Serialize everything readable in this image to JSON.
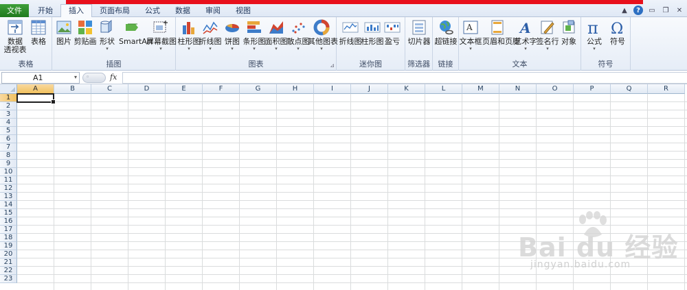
{
  "menu": {
    "tabs": [
      {
        "label": "文件"
      },
      {
        "label": "开始"
      },
      {
        "label": "插入"
      },
      {
        "label": "页面布局"
      },
      {
        "label": "公式"
      },
      {
        "label": "数据"
      },
      {
        "label": "审阅"
      },
      {
        "label": "视图"
      }
    ],
    "active_tab": "插入"
  },
  "ribbon": {
    "groups": {
      "tables": {
        "label": "表格",
        "pivot_line1": "数据",
        "pivot_line2": "透视表",
        "table": "表格"
      },
      "illustrations": {
        "label": "插图",
        "picture": "图片",
        "clipart": "剪贴画",
        "shapes": "形状",
        "smartart": "SmartArt",
        "screenshot": "屏幕截图"
      },
      "charts": {
        "label": "图表",
        "column": "柱形图",
        "line": "折线图",
        "pie": "饼图",
        "bar": "条形图",
        "area": "面积图",
        "scatter": "散点图",
        "other": "其他图表"
      },
      "sparklines": {
        "label": "迷你图",
        "line": "折线图",
        "column": "柱形图",
        "winloss": "盈亏"
      },
      "filter": {
        "label": "筛选器",
        "slicer": "切片器"
      },
      "links": {
        "label": "链接",
        "hyperlink": "超链接"
      },
      "text": {
        "label": "文本",
        "textbox": "文本框",
        "headerfooter": "页眉和页脚",
        "wordart": "艺术字",
        "signature": "签名行",
        "object": "对象"
      },
      "symbols": {
        "label": "符号",
        "equation": "公式",
        "symbol": "符号"
      }
    }
  },
  "formula_bar": {
    "name_box": "A1",
    "fx_label": "fx",
    "value": ""
  },
  "sheet": {
    "columns": [
      "A",
      "B",
      "C",
      "D",
      "E",
      "F",
      "G",
      "H",
      "I",
      "J",
      "K",
      "L",
      "M",
      "N",
      "O",
      "P",
      "Q",
      "R"
    ],
    "rows": [
      "1",
      "2",
      "3",
      "4",
      "5",
      "6",
      "7",
      "8",
      "9",
      "10",
      "11",
      "12",
      "13",
      "14",
      "15",
      "16",
      "17",
      "18",
      "19",
      "20",
      "21",
      "22",
      "23"
    ],
    "selected_cell": "A1"
  },
  "watermark": {
    "brand": "Bai du 经验",
    "site": "jingyan.baidu.com"
  },
  "colors": {
    "file_tab": "#2b8a28",
    "title_red": "#e8101c",
    "header_selected": "#f5cc7a",
    "gridline": "#dadcdd"
  }
}
